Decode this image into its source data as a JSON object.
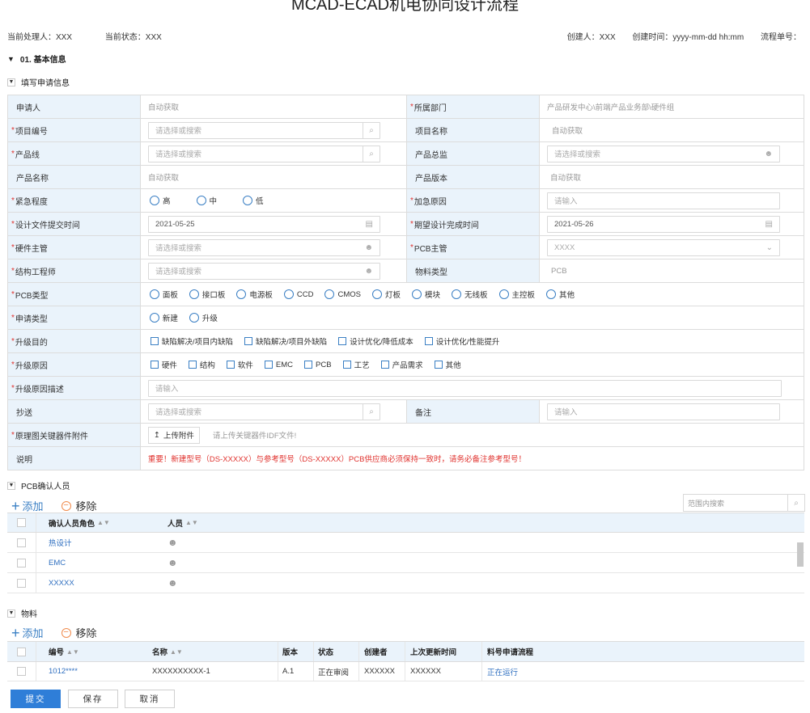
{
  "page": {
    "title": "MCAD-ECAD机电协同设计流程",
    "current_handler": "当前处理人：XXX",
    "current_status": "当前状态：XXX",
    "creator": "创建人：XXX",
    "create_time": "创建时间：yyyy-mm-dd hh:mm",
    "flow_no": "流程单号："
  },
  "section_basic": {
    "heading": "01. 基本信息",
    "sub_heading": "填写申请信息"
  },
  "form": {
    "applicant_label": "申请人",
    "applicant_value": "自动获取",
    "dept_label": "所属部门",
    "dept_value": "产品研发中心\\前端产品业务部\\硬件组",
    "project_no_label": "项目编号",
    "project_no_placeholder": "请选择或搜索",
    "project_name_label": "项目名称",
    "project_name_value": "自动获取",
    "product_line_label": "产品线",
    "product_line_placeholder": "请选择或搜索",
    "product_director_label": "产品总监",
    "product_director_placeholder": "请选择或搜索",
    "product_name_label": "产品名称",
    "product_name_value": "自动获取",
    "product_version_label": "产品版本",
    "product_version_value": "自动获取",
    "urgency_label": "紧急程度",
    "urgency_options": [
      "高",
      "中",
      "低"
    ],
    "urgent_reason_label": "加急原因",
    "urgent_reason_placeholder": "请输入",
    "design_submit_label": "设计文件提交时间",
    "design_submit_value": "2021-05-25",
    "expected_finish_label": "期望设计完成时间",
    "expected_finish_value": "2021-05-26",
    "hw_manager_label": "硬件主管",
    "hw_manager_placeholder": "请选择或搜索",
    "pcb_manager_label": "PCB主管",
    "pcb_manager_value": "XXXX",
    "struct_engineer_label": "结构工程师",
    "struct_engineer_placeholder": "请选择或搜索",
    "material_type_label": "物料类型",
    "material_type_value": "PCB",
    "pcb_type_label": "PCB类型",
    "pcb_type_options": [
      "面板",
      "接口板",
      "电源板",
      "CCD",
      "CMOS",
      "灯板",
      "模块",
      "无线板",
      "主控板",
      "其他"
    ],
    "apply_type_label": "申请类型",
    "apply_type_options": [
      "新建",
      "升级"
    ],
    "upgrade_purpose_label": "升级目的",
    "upgrade_purpose_options": [
      "缺陷解决/项目内缺陷",
      "缺陷解决/项目外缺陷",
      "设计优化/降低成本",
      "设计优化/性能提升"
    ],
    "upgrade_reason_label": "升级原因",
    "upgrade_reason_options": [
      "硬件",
      "结构",
      "软件",
      "EMC",
      "PCB",
      "工艺",
      "产品需求",
      "其他"
    ],
    "upgrade_desc_label": "升级原因描述",
    "upgrade_desc_placeholder": "请输入",
    "cc_label": "抄送",
    "cc_placeholder": "请选择或搜索",
    "remark_label": "备注",
    "remark_placeholder": "请输入",
    "attachment_label": "原理图关键器件附件",
    "upload_label": "上传附件",
    "upload_hint": "请上传关键器件IDF文件!",
    "note_label": "说明",
    "note_value": "重要！新建型号（DS-XXXXX）与参考型号（DS-XXXXX）PCB供应商必须保持一致时，请务必备注参考型号！"
  },
  "pcb_confirm": {
    "heading": "PCB确认人员",
    "add_label": "添加",
    "remove_label": "移除",
    "search_placeholder": "范围内搜索",
    "col_role": "确认人员角色",
    "col_person": "人员",
    "rows": [
      {
        "role": "热设计"
      },
      {
        "role": "EMC"
      },
      {
        "role": "XXXXX"
      }
    ]
  },
  "materials": {
    "heading": "物料",
    "add_label": "添加",
    "remove_label": "移除",
    "col_no": "编号",
    "col_name": "名称",
    "col_version": "版本",
    "col_status": "状态",
    "col_creator": "创建者",
    "col_updated": "上次更新时间",
    "col_flow": "料号申请流程",
    "rows": [
      {
        "no": "1012****",
        "name": "XXXXXXXXXX-1",
        "version": "A.1",
        "status": "正在审阅",
        "creator": "XXXXXX",
        "updated": "XXXXXX",
        "flow": "正在运行"
      }
    ]
  },
  "actions": {
    "submit": "提交",
    "save": "保存",
    "cancel": "取消"
  },
  "colors": {
    "accent": "#2f7ed8",
    "label_bg": "#eaf3fb",
    "required": "#e0322e"
  }
}
